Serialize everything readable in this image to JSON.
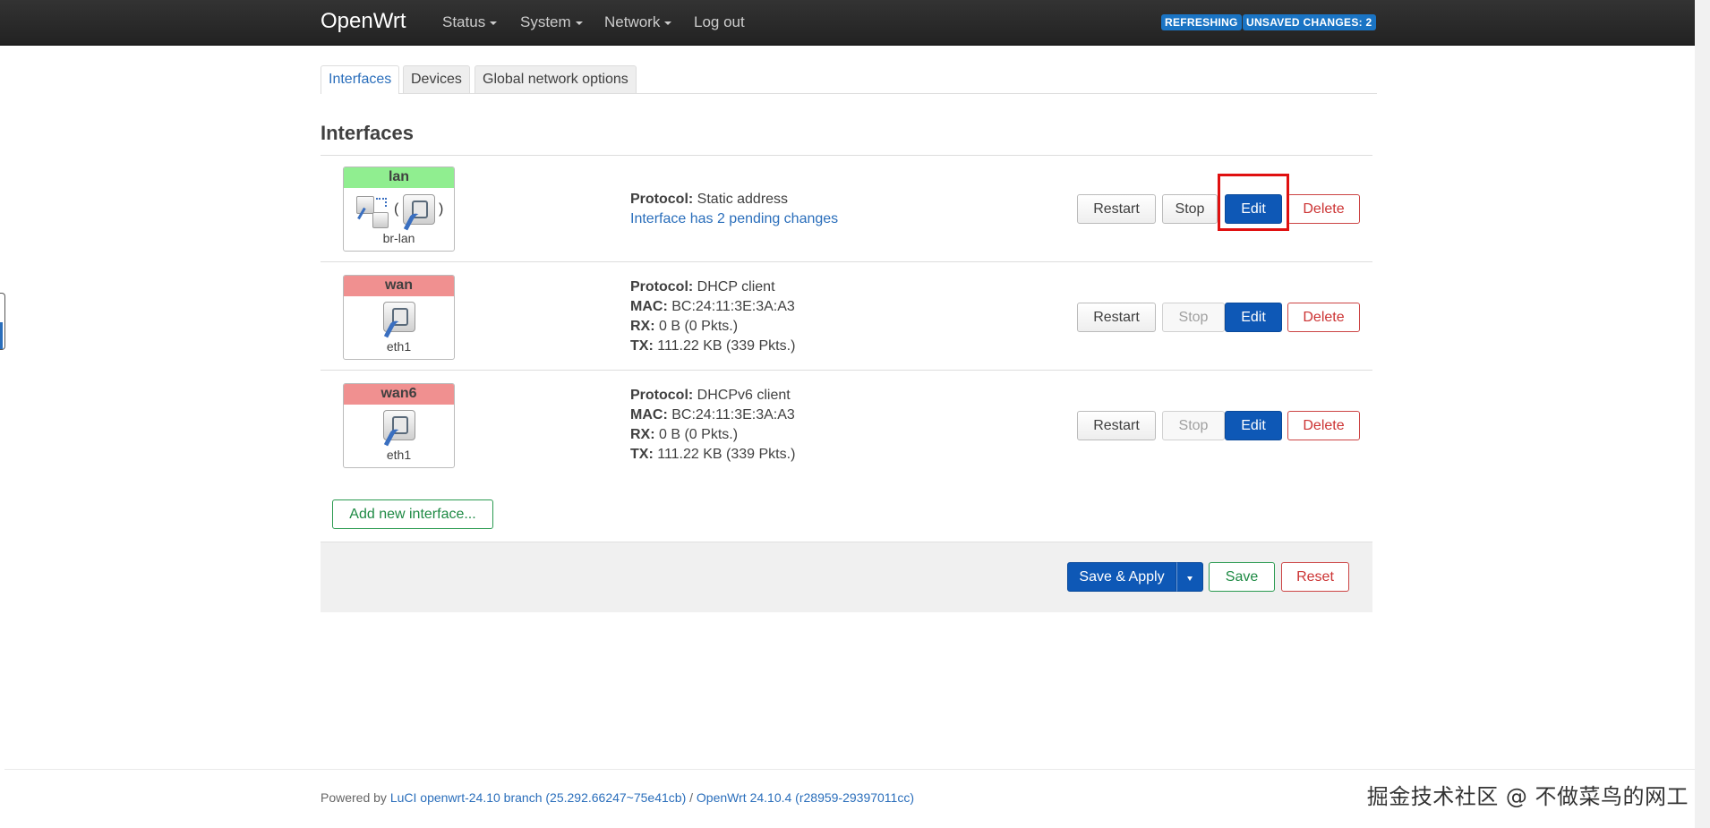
{
  "header": {
    "brand": "OpenWrt",
    "menus": [
      "Status",
      "System",
      "Network"
    ],
    "logout": "Log out",
    "badges": {
      "refreshing": "REFRESHING",
      "unsaved": "UNSAVED CHANGES: 2"
    }
  },
  "tabs": [
    "Interfaces",
    "Devices",
    "Global network options"
  ],
  "section_title": "Interfaces",
  "interfaces": [
    {
      "name": "lan",
      "device": "br-lan",
      "status": "up",
      "protocol_label": "Protocol:",
      "protocol": "Static address",
      "pending": "Interface has 2 pending changes"
    },
    {
      "name": "wan",
      "device": "eth1",
      "status": "down",
      "protocol_label": "Protocol:",
      "protocol": "DHCP client",
      "mac_label": "MAC:",
      "mac": "BC:24:11:3E:3A:A3",
      "rx_label": "RX:",
      "rx": "0 B (0 Pkts.)",
      "tx_label": "TX:",
      "tx": "111.22 KB (339 Pkts.)"
    },
    {
      "name": "wan6",
      "device": "eth1",
      "status": "down",
      "protocol_label": "Protocol:",
      "protocol": "DHCPv6 client",
      "mac_label": "MAC:",
      "mac": "BC:24:11:3E:3A:A3",
      "rx_label": "RX:",
      "rx": "0 B (0 Pkts.)",
      "tx_label": "TX:",
      "tx": "111.22 KB (339 Pkts.)"
    }
  ],
  "row_buttons": {
    "restart": "Restart",
    "stop": "Stop",
    "edit": "Edit",
    "delete": "Delete"
  },
  "add_interface": "Add new interface...",
  "actions": {
    "save_apply": "Save & Apply",
    "save": "Save",
    "reset": "Reset"
  },
  "footer": {
    "powered_by": "Powered by",
    "luci": "LuCI openwrt-24.10 branch (25.292.66247~75e41cb)",
    "sep": "/",
    "openwrt": "OpenWrt 24.10.4 (r28959-29397011cc)"
  },
  "watermark": "掘金技术社区 @ 不做菜鸟的网工",
  "colors": {
    "accent": "#0e58b6",
    "up": "#90ee90",
    "down": "#f09090",
    "danger": "#cc3333",
    "positive": "#1e8a44",
    "highlight": "#e01010"
  }
}
